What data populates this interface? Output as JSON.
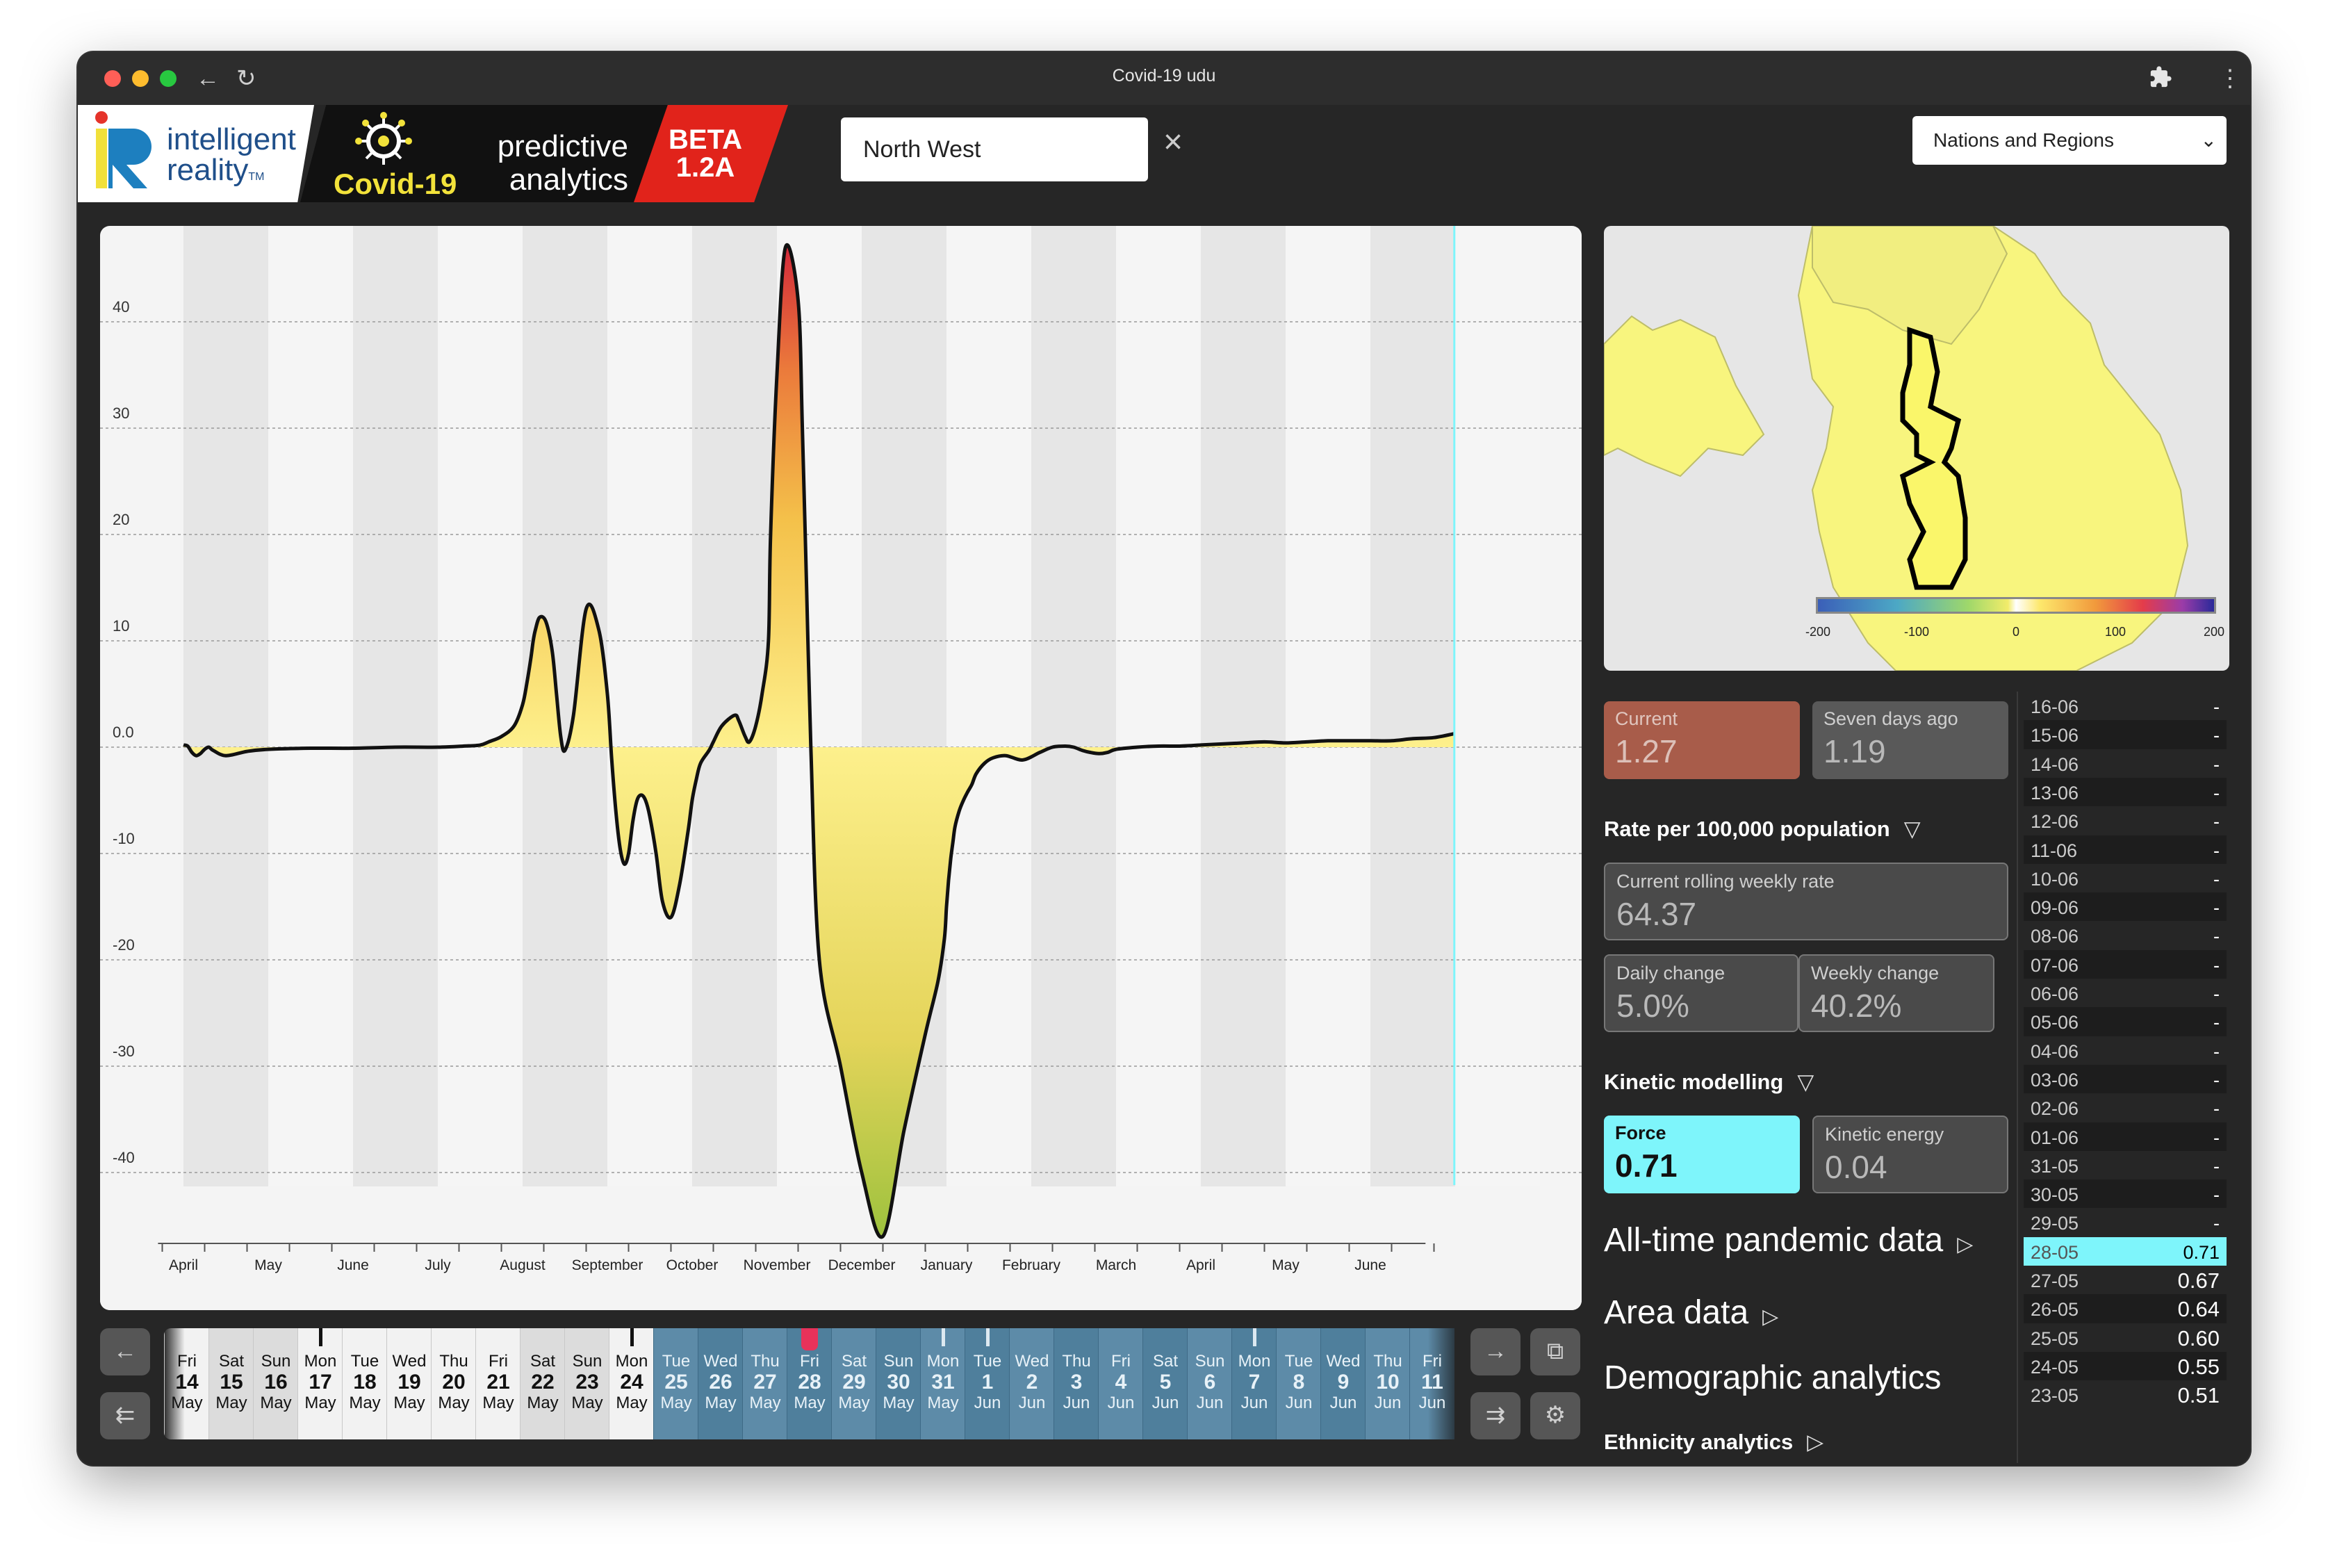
{
  "window": {
    "title": "Covid-19 udu"
  },
  "brand": {
    "ir_line1": "intelligent",
    "ir_line2": "reality",
    "ir_tm": "TM",
    "predictive": "predictive",
    "analytics": "analytics",
    "covid": "Covid-19",
    "beta": "BETA",
    "version": "1.2A"
  },
  "search": {
    "value": "North West"
  },
  "region_select": {
    "value": "Nations and Regions"
  },
  "chart_data": {
    "type": "area",
    "ylim": [
      -47,
      47
    ],
    "yticks": [
      "40",
      "30",
      "20",
      "10",
      "0.0",
      "-10",
      "-20",
      "-30",
      "-40"
    ],
    "x_labels": [
      "April",
      "May",
      "June",
      "July",
      "August",
      "September",
      "October",
      "November",
      "December",
      "January",
      "February",
      "March",
      "April",
      "May",
      "June"
    ],
    "x": [
      0,
      0.1,
      0.2,
      0.3,
      0.4,
      0.5,
      0.6,
      0.7,
      1,
      1.5,
      2,
      3,
      4,
      5,
      6,
      6.6,
      7,
      7.2,
      7.5,
      7.8,
      8.0,
      8.1,
      8.2,
      8.25,
      8.3,
      8.4,
      8.55,
      8.7,
      8.8,
      8.9,
      9.0,
      9.2,
      9.5,
      9.8,
      10,
      10.1,
      10.2,
      10.3,
      10.4,
      10.5,
      10.6,
      10.7,
      10.8,
      10.9,
      11,
      11.15,
      11.3,
      11.5,
      11.7,
      11.9,
      12.0,
      12.1,
      12.2,
      12.4,
      12.5,
      12.7,
      13.0,
      13.1,
      13.25,
      13.35,
      13.5,
      13.65,
      13.8,
      13.85,
      14,
      14.2,
      14.5,
      14.6,
      14.7,
      14.8,
      15,
      15.5,
      16,
      16.5,
      17,
      17.5,
      17.8,
      17.95,
      18,
      18.05,
      18.1,
      18.15,
      18.2,
      18.3,
      18.4,
      18.5,
      18.6,
      18.7,
      18.9,
      19.1,
      19.4,
      19.8,
      20.2,
      20.5,
      20.8,
      21,
      21.2,
      21.4,
      21.6,
      21.8,
      22,
      22.5,
      23,
      23.5,
      24,
      24.5,
      25,
      25.5,
      26,
      26.5,
      27,
      27.5,
      28,
      28.5,
      29,
      29.5,
      29.98
    ],
    "values": [
      0.2,
      0.1,
      -0.5,
      -0.8,
      -0.6,
      -0.2,
      0.0,
      -0.3,
      -0.8,
      -0.4,
      -0.2,
      -0.1,
      -0.1,
      0.0,
      0.0,
      0.1,
      0.2,
      0.5,
      1.0,
      2.0,
      4.0,
      6.0,
      8.5,
      10.0,
      11.0,
      12.2,
      11.8,
      9.0,
      5.0,
      1.0,
      -0.3,
      3.0,
      13.0,
      11.0,
      5.0,
      -1.0,
      -6.0,
      -9.5,
      -11.0,
      -10.0,
      -7.0,
      -5.0,
      -4.5,
      -5.0,
      -6.5,
      -10.0,
      -14.5,
      -16.0,
      -13.0,
      -8.0,
      -5.0,
      -3.0,
      -1.5,
      -0.3,
      0.5,
      2.0,
      3.0,
      2.5,
      1.0,
      0.5,
      2.0,
      5.0,
      10.0,
      20.0,
      35.0,
      47.0,
      42.0,
      30.0,
      15.0,
      0.0,
      -20.0,
      -30.0,
      -40.0,
      -46.0,
      -36.0,
      -27.0,
      -22.0,
      -18.0,
      -15.0,
      -12.5,
      -10.5,
      -9.0,
      -7.5,
      -6.0,
      -5.0,
      -4.2,
      -3.5,
      -2.5,
      -1.5,
      -1.0,
      -0.8,
      -1.2,
      -0.5,
      0.0,
      0.1,
      0.0,
      -0.3,
      -0.5,
      -0.6,
      -0.5,
      -0.2,
      0.0,
      0.1,
      0.1,
      0.2,
      0.3,
      0.4,
      0.5,
      0.4,
      0.5,
      0.6,
      0.6,
      0.6,
      0.6,
      0.8,
      0.9,
      1.27
    ]
  },
  "map": {
    "legend_ticks": [
      "-200",
      "-100",
      "0",
      "100",
      "200"
    ]
  },
  "stats": {
    "current": {
      "label": "Current",
      "value": "1.27"
    },
    "seven_days": {
      "label": "Seven days ago",
      "value": "1.19"
    },
    "rate_heading": "Rate per 100,000 population",
    "rolling": {
      "label": "Current rolling weekly rate",
      "value": "64.37"
    },
    "daily": {
      "label": "Daily change",
      "value": "5.0%"
    },
    "weekly": {
      "label": "Weekly change",
      "value": "40.2%"
    },
    "kinetic_heading": "Kinetic modelling",
    "force": {
      "label": "Force",
      "value": "0.71"
    },
    "kinetic_energy": {
      "label": "Kinetic energy",
      "value": "0.04"
    }
  },
  "sections": {
    "all_time": "All-time pandemic data",
    "area": "Area data",
    "demographic": "Demographic analytics",
    "ethnicity": "Ethnicity analytics"
  },
  "date_values": [
    {
      "date": "16-06",
      "value": "-"
    },
    {
      "date": "15-06",
      "value": "-"
    },
    {
      "date": "14-06",
      "value": "-"
    },
    {
      "date": "13-06",
      "value": "-"
    },
    {
      "date": "12-06",
      "value": "-"
    },
    {
      "date": "11-06",
      "value": "-"
    },
    {
      "date": "10-06",
      "value": "-"
    },
    {
      "date": "09-06",
      "value": "-"
    },
    {
      "date": "08-06",
      "value": "-"
    },
    {
      "date": "07-06",
      "value": "-"
    },
    {
      "date": "06-06",
      "value": "-"
    },
    {
      "date": "05-06",
      "value": "-"
    },
    {
      "date": "04-06",
      "value": "-"
    },
    {
      "date": "03-06",
      "value": "-"
    },
    {
      "date": "02-06",
      "value": "-"
    },
    {
      "date": "01-06",
      "value": "-"
    },
    {
      "date": "31-05",
      "value": "-"
    },
    {
      "date": "30-05",
      "value": "-"
    },
    {
      "date": "29-05",
      "value": "-"
    },
    {
      "date": "28-05",
      "value": "0.71"
    },
    {
      "date": "27-05",
      "value": "0.67"
    },
    {
      "date": "26-05",
      "value": "0.64"
    },
    {
      "date": "25-05",
      "value": "0.60"
    },
    {
      "date": "24-05",
      "value": "0.55"
    },
    {
      "date": "23-05",
      "value": "0.51"
    }
  ],
  "timeline_days": [
    {
      "name": "Fri",
      "date": "14",
      "month": "May"
    },
    {
      "name": "Sat",
      "date": "15",
      "month": "May"
    },
    {
      "name": "Sun",
      "date": "16",
      "month": "May"
    },
    {
      "name": "Mon",
      "date": "17",
      "month": "May"
    },
    {
      "name": "Tue",
      "date": "18",
      "month": "May"
    },
    {
      "name": "Wed",
      "date": "19",
      "month": "May"
    },
    {
      "name": "Thu",
      "date": "20",
      "month": "May"
    },
    {
      "name": "Fri",
      "date": "21",
      "month": "May"
    },
    {
      "name": "Sat",
      "date": "22",
      "month": "May"
    },
    {
      "name": "Sun",
      "date": "23",
      "month": "May"
    },
    {
      "name": "Mon",
      "date": "24",
      "month": "May"
    },
    {
      "name": "Tue",
      "date": "25",
      "month": "May"
    },
    {
      "name": "Wed",
      "date": "26",
      "month": "May"
    },
    {
      "name": "Thu",
      "date": "27",
      "month": "May"
    },
    {
      "name": "Fri",
      "date": "28",
      "month": "May"
    },
    {
      "name": "Sat",
      "date": "29",
      "month": "May"
    },
    {
      "name": "Sun",
      "date": "30",
      "month": "May"
    },
    {
      "name": "Mon",
      "date": "31",
      "month": "May"
    },
    {
      "name": "Tue",
      "date": "1",
      "month": "Jun"
    },
    {
      "name": "Wed",
      "date": "2",
      "month": "Jun"
    },
    {
      "name": "Thu",
      "date": "3",
      "month": "Jun"
    },
    {
      "name": "Fri",
      "date": "4",
      "month": "Jun"
    },
    {
      "name": "Sat",
      "date": "5",
      "month": "Jun"
    },
    {
      "name": "Sun",
      "date": "6",
      "month": "Jun"
    },
    {
      "name": "Mon",
      "date": "7",
      "month": "Jun"
    },
    {
      "name": "Tue",
      "date": "8",
      "month": "Jun"
    },
    {
      "name": "Wed",
      "date": "9",
      "month": "Jun"
    },
    {
      "name": "Thu",
      "date": "10",
      "month": "Jun"
    },
    {
      "name": "Fri",
      "date": "11",
      "month": "Jun"
    }
  ],
  "colors": {
    "highlight": "#7ef5fb",
    "current_card": "#a85c4a",
    "future_day": "#4f7f9c",
    "selected_day_marker": "#e8325a"
  },
  "icons": {
    "back": "arrow-left-icon",
    "reload": "reload-icon",
    "extensions": "puzzle-icon",
    "menu": "kebab-menu-icon",
    "clear": "close-icon",
    "prev": "arrow-left-icon",
    "first": "double-arrow-left-icon",
    "next": "arrow-right-icon",
    "last": "double-arrow-right-icon",
    "share": "export-icon",
    "settings": "gear-icon"
  }
}
